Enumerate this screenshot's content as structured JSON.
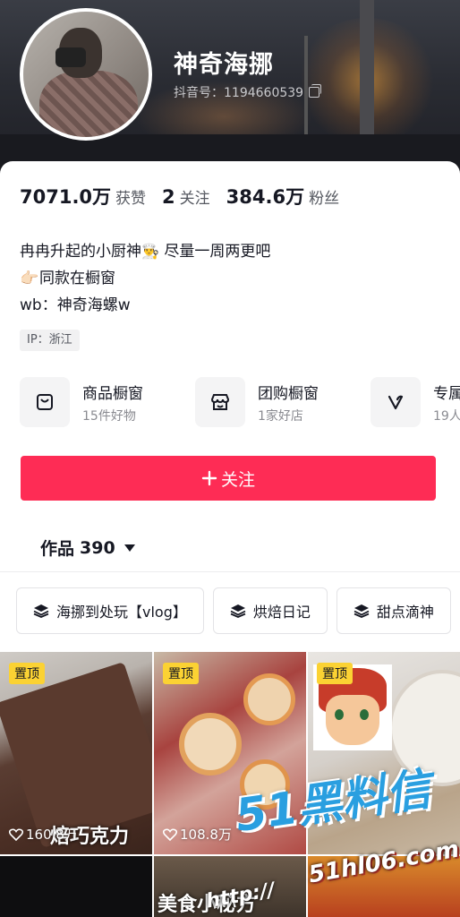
{
  "profile": {
    "name": "神奇海挪",
    "douyin_id": "抖音号：1194660539"
  },
  "stats": {
    "likes_num": "7071.0万",
    "likes_label": "获赞",
    "following_num": "2",
    "following_label": "关注",
    "fans_num": "384.6万",
    "fans_label": "粉丝"
  },
  "bio": {
    "line1": "冉冉升起的小厨神",
    "line1_emoji": "👨‍🍳",
    "line1_tail": " 尽量一周两更吧",
    "line2_emoji": "👉🏻",
    "line2": "同款在橱窗",
    "line3": "wb：神奇海螺w"
  },
  "ip_tag": "IP：浙江",
  "shops": [
    {
      "title": "商品橱窗",
      "sub": "15件好物",
      "icon": "bag-icon"
    },
    {
      "title": "团购橱窗",
      "sub": "1家好店",
      "icon": "store-icon"
    },
    {
      "title": "专属",
      "sub": "19人",
      "icon": "v-icon"
    }
  ],
  "follow_button": "关注",
  "works_tab": {
    "label": "作品",
    "count": "390"
  },
  "collections": [
    "海挪到处玩【vlog】",
    "烘焙日记",
    "甜点滴神"
  ],
  "videos": [
    {
      "pin": "置顶",
      "likes": "160.8万",
      "overlay": "焙巧克力"
    },
    {
      "pin": "置顶",
      "likes": "108.8万"
    },
    {
      "pin": "置顶"
    },
    {
      "overlay": "美食小秘方"
    }
  ],
  "watermark": {
    "brand": "51黑料信",
    "url": "51hl06.com",
    "url_prefix": "http://"
  },
  "colors": {
    "accent": "#fe2c55",
    "pin": "#fbd233"
  }
}
